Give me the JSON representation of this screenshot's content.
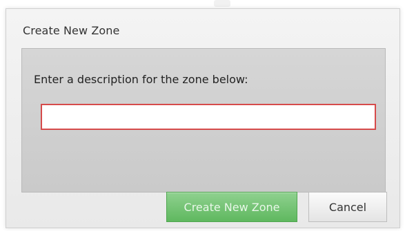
{
  "dialog": {
    "title": "Create New Zone",
    "prompt": "Enter a description for the zone below:",
    "description_input": {
      "value": "",
      "placeholder": ""
    },
    "buttons": {
      "create_label": "Create New Zone",
      "cancel_label": "Cancel"
    }
  },
  "colors": {
    "create_button": "#66bb66",
    "input_border": "#d64a4a",
    "panel_background": "#d0d0d0",
    "dialog_background": "#efefef"
  }
}
